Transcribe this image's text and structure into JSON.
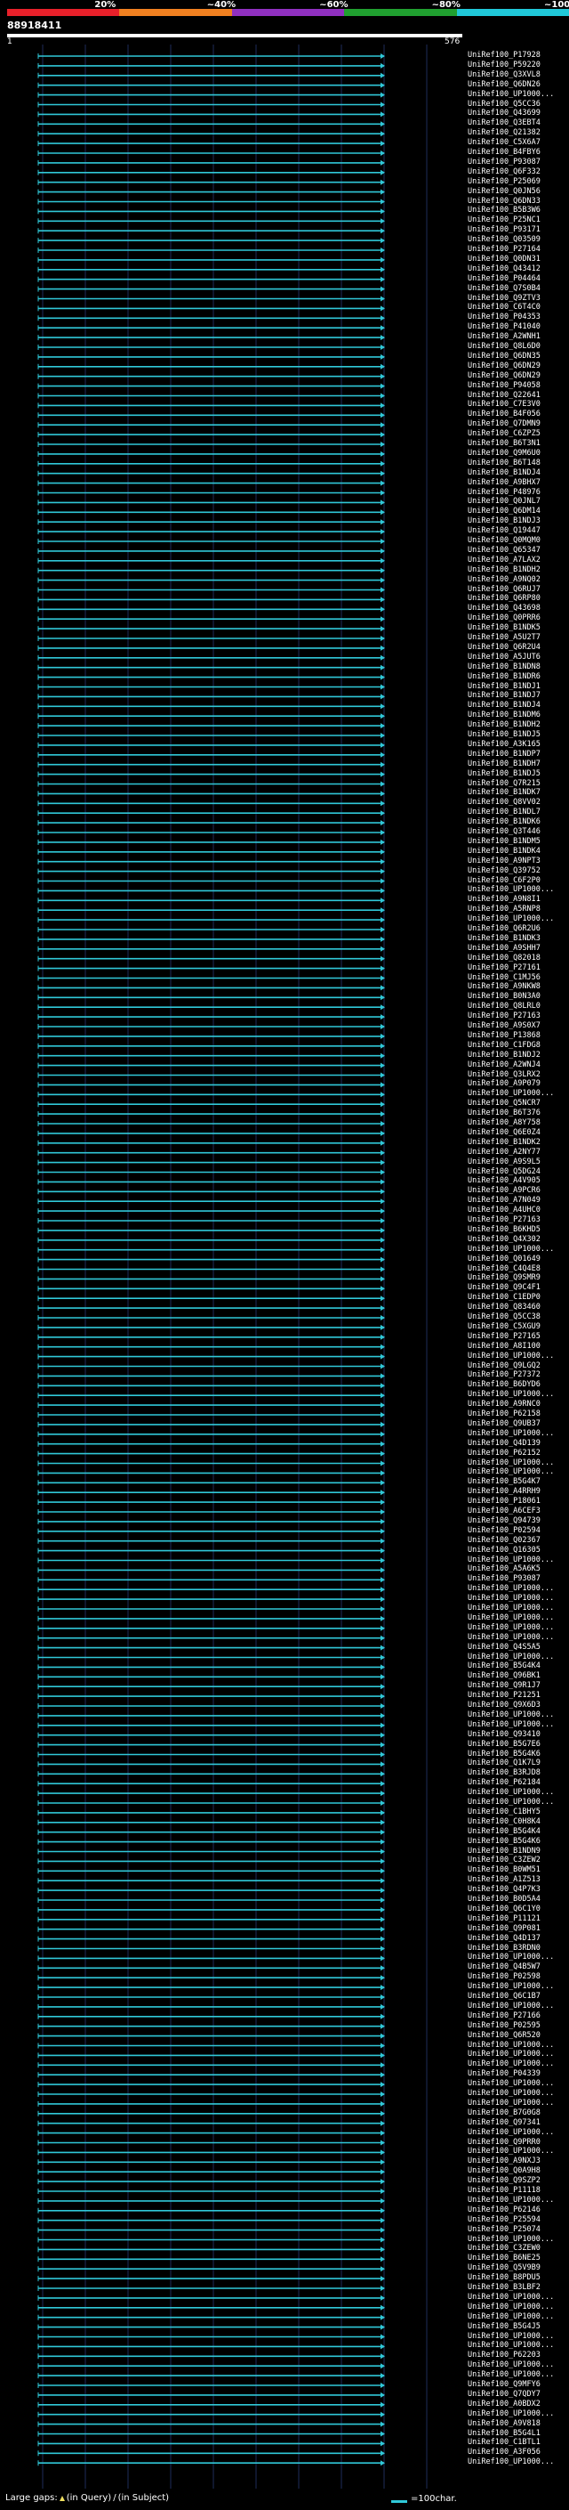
{
  "scale": {
    "colors": [
      "#e8202a",
      "#f08020",
      "#9030c0",
      "#20a030",
      "#20c8d8"
    ],
    "labels": [
      "20%",
      "~40%",
      "~60%",
      "~80%",
      "~100%"
    ]
  },
  "query_id": "88918411",
  "ruler": {
    "start": "1",
    "end": "576"
  },
  "legend": {
    "large_gaps_label": "Large gaps:",
    "in_query": "(in Query)",
    "in_subject": "(in Subject)",
    "bar_label": "=100char."
  },
  "colors": {
    "hit": "#30c8d8",
    "gap_mark": "#f0e060",
    "grid": "#1e2c5a"
  },
  "hits": [
    "UniRef100_P17928",
    "UniRef100_P59220",
    "UniRef100_Q3XVL8",
    "UniRef100_Q6DN26",
    "UniRef100_UP1000...",
    "UniRef100_Q5CC36",
    "UniRef100_Q43699",
    "UniRef100_Q3EBT4",
    "UniRef100_Q21382",
    "UniRef100_C5X6A7",
    "UniRef100_B4FBY6",
    "UniRef100_P93087",
    "UniRef100_Q6F332",
    "UniRef100_P25069",
    "UniRef100_Q0JN56",
    "UniRef100_Q6DN33",
    "UniRef100_B5B3W6",
    "UniRef100_P25NC1",
    "UniRef100_P93171",
    "UniRef100_Q03509",
    "UniRef100_P27164",
    "UniRef100_Q0DN31",
    "UniRef100_Q43412",
    "UniRef100_P04464",
    "UniRef100_Q7S0B4",
    "UniRef100_Q9ZTV3",
    "UniRef100_C6T4C0",
    "UniRef100_P04353",
    "UniRef100_P41040",
    "UniRef100_A2WNH1",
    "UniRef100_Q8L6D0",
    "UniRef100_Q6DN35",
    "UniRef100_Q6DN29",
    "UniRef100_Q6DN29",
    "UniRef100_P94058",
    "UniRef100_Q22641",
    "UniRef100_C7E3V0",
    "UniRef100_B4F056",
    "UniRef100_Q7DMN9",
    "UniRef100_C6ZPZ5",
    "UniRef100_B6T3N1",
    "UniRef100_Q9M6U0",
    "UniRef100_B6T148",
    "UniRef100_B1NDJ4",
    "UniRef100_A9BHX7",
    "UniRef100_P48976",
    "UniRef100_Q0JNL7",
    "UniRef100_Q6DM14",
    "UniRef100_B1NDJ3",
    "UniRef100_Q19447",
    "UniRef100_Q0MQM0",
    "UniRef100_Q65347",
    "UniRef100_A7LAX2",
    "UniRef100_B1NDH2",
    "UniRef100_A9NQ02",
    "UniRef100_Q6RUJ7",
    "UniRef100_Q6RP80",
    "UniRef100_Q43698",
    "UniRef100_Q0PRR6",
    "UniRef100_B1NDK5",
    "UniRef100_A5U2T7",
    "UniRef100_Q6R2U4",
    "UniRef100_A5JUT6",
    "UniRef100_B1NDN8",
    "UniRef100_B1NDR6",
    "UniRef100_B1NDJ1",
    "UniRef100_B1NDJ7",
    "UniRef100_B1NDJ4",
    "UniRef100_B1NDM6",
    "UniRef100_B1NDH2",
    "UniRef100_B1NDJ5",
    "UniRef100_A3K165",
    "UniRef100_B1NDP7",
    "UniRef100_B1NDH7",
    "UniRef100_B1NDJ5",
    "UniRef100_Q7R215",
    "UniRef100_B1NDK7",
    "UniRef100_Q8VV02",
    "UniRef100_B1NDL7",
    "UniRef100_B1NDK6",
    "UniRef100_Q3T446",
    "UniRef100_B1NDM5",
    "UniRef100_B1NDK4",
    "UniRef100_A9NPT3",
    "UniRef100_Q39752",
    "UniRef100_C6F2P0",
    "UniRef100_UP1000...",
    "UniRef100_A9N8I1",
    "UniRef100_A5RNP8",
    "UniRef100_UP1000...",
    "UniRef100_Q6R2U6",
    "UniRef100_B1NDK3",
    "UniRef100_A9SHH7",
    "UniRef100_Q82018",
    "UniRef100_P27161",
    "UniRef100_C1MJ56",
    "UniRef100_A9NKW8",
    "UniRef100_B0N3A0",
    "UniRef100_Q8LRL0",
    "UniRef100_P27163",
    "UniRef100_A9S0X7",
    "UniRef100_P13868",
    "UniRef100_C1FDG8",
    "UniRef100_B1NDJ2",
    "UniRef100_A2WNJ4",
    "UniRef100_Q3LRX2",
    "UniRef100_A9P079",
    "UniRef100_UP1000...",
    "UniRef100_Q5NCR7",
    "UniRef100_B6T376",
    "UniRef100_A8Y758",
    "UniRef100_Q6E0Z4",
    "UniRef100_B1NDK2",
    "UniRef100_A2NY77",
    "UniRef100_A9S9L5",
    "UniRef100_Q5DG24",
    "UniRef100_A4V905",
    "UniRef100_A9PCR6",
    "UniRef100_A7N049",
    "UniRef100_A4UHC0",
    "UniRef100_P27163",
    "UniRef100_B6KHD5",
    "UniRef100_Q4X302",
    "UniRef100_UP1000...",
    "UniRef100_Q01649",
    "UniRef100_C4Q4E8",
    "UniRef100_Q9SMR9",
    "UniRef100_Q9C4F1",
    "UniRef100_C1EDP0",
    "UniRef100_Q83460",
    "UniRef100_Q5CC38",
    "UniRef100_C5XGU9",
    "UniRef100_P27165",
    "UniRef100_A8I100",
    "UniRef100_UP1000...",
    "UniRef100_Q9LGQ2",
    "UniRef100_P27372",
    "UniRef100_B6DYD6",
    "UniRef100_UP1000...",
    "UniRef100_A9RNC0",
    "UniRef100_P62158",
    "UniRef100_Q9UB37",
    "UniRef100_UP1000...",
    "UniRef100_Q4D139",
    "UniRef100_P62152",
    "UniRef100_UP1000...",
    "UniRef100_UP1000...",
    "UniRef100_B5G4K7",
    "UniRef100_A4RRH9",
    "UniRef100_P18061",
    "UniRef100_A6CEF3",
    "UniRef100_Q94739",
    "UniRef100_P02594",
    "UniRef100_Q02367",
    "UniRef100_Q16305",
    "UniRef100_UP1000...",
    "UniRef100_A5A6K5",
    "UniRef100_P93087",
    "UniRef100_UP1000...",
    "UniRef100_UP1000...",
    "UniRef100_UP1000...",
    "UniRef100_UP1000...",
    "UniRef100_UP1000...",
    "UniRef100_UP1000...",
    "UniRef100_Q4S5A5",
    "UniRef100_UP1000...",
    "UniRef100_B5G4K4",
    "UniRef100_Q96BK1",
    "UniRef100_Q9R1J7",
    "UniRef100_P21251",
    "UniRef100_Q9X6D3",
    "UniRef100_UP1000...",
    "UniRef100_UP1000...",
    "UniRef100_Q93410",
    "UniRef100_B5G7E6",
    "UniRef100_B5G4K6",
    "UniRef100_Q1K7L9",
    "UniRef100_B3RJD8",
    "UniRef100_P62184",
    "UniRef100_UP1000...",
    "UniRef100_UP1000...",
    "UniRef100_C1BHY5",
    "UniRef100_C0H8K4",
    "UniRef100_B5G4K4",
    "UniRef100_B5G4K6",
    "UniRef100_B1NDN9",
    "UniRef100_C3ZEW2",
    "UniRef100_B0WM51",
    "UniRef100_A1Z513",
    "UniRef100_Q4P7K3",
    "UniRef100_B0D5A4",
    "UniRef100_Q6C1Y0",
    "UniRef100_P11121",
    "UniRef100_Q9P081",
    "UniRef100_Q4D137",
    "UniRef100_B3RDN0",
    "UniRef100_UP1000...",
    "UniRef100_Q4B5W7",
    "UniRef100_P02598",
    "UniRef100_UP1000...",
    "UniRef100_Q6C1B7",
    "UniRef100_UP1000...",
    "UniRef100_P27166",
    "UniRef100_P02595",
    "UniRef100_Q6R520",
    "UniRef100_UP1000...",
    "UniRef100_UP1000...",
    "UniRef100_UP1000...",
    "UniRef100_P04339",
    "UniRef100_UP1000...",
    "UniRef100_UP1000...",
    "UniRef100_UP1000...",
    "UniRef100_B7G0G8",
    "UniRef100_Q97341",
    "UniRef100_UP1000...",
    "UniRef100_Q9PRR0",
    "UniRef100_UP1000...",
    "UniRef100_A9NXJ3",
    "UniRef100_Q0A9H8",
    "UniRef100_Q9SZP2",
    "UniRef100_P11118",
    "UniRef100_UP1000...",
    "UniRef100_P62146",
    "UniRef100_P25594",
    "UniRef100_P25074",
    "UniRef100_UP1000...",
    "UniRef100_C3ZEW0",
    "UniRef100_B6NE25",
    "UniRef100_Q5V9B9",
    "UniRef100_B8PDU5",
    "UniRef100_B3LBF2",
    "UniRef100_UP1000...",
    "UniRef100_UP1000...",
    "UniRef100_UP1000...",
    "UniRef100_B5G4J5",
    "UniRef100_UP1000...",
    "UniRef100_UP1000...",
    "UniRef100_P62203",
    "UniRef100_UP1000...",
    "UniRef100_UP1000...",
    "UniRef100_Q9MFY6",
    "UniRef100_Q7QDY7",
    "UniRef100_A0BDX2",
    "UniRef100_UP1000...",
    "UniRef100_A9V818",
    "UniRef100_B5G4L1",
    "UniRef100_C1BTL1",
    "UniRef100_A3F056",
    "UniRef100_UP1000..."
  ]
}
